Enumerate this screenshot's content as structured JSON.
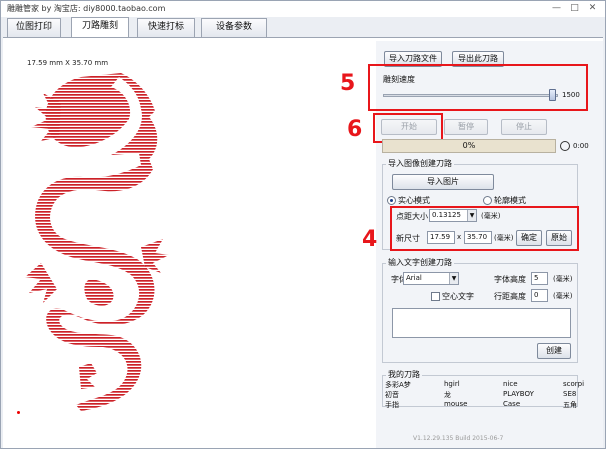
{
  "window": {
    "title": "雕雕管家 by 淘宝店: diy8000.taobao.com",
    "min": "—",
    "max": "□",
    "close": "✕"
  },
  "tabs": [
    "位图打印",
    "刀路雕刻",
    "快速打标",
    "设备参数"
  ],
  "canvas": {
    "dimension_label": "17.59 mm X 35.70 mm"
  },
  "toolbar": {
    "import_path": "导入刀路文件",
    "export_path": "导出此刀路"
  },
  "speed": {
    "label": "雕刻速度",
    "value": "1500",
    "level": 0.97
  },
  "controls": {
    "start": "开始",
    "pause": "暂停",
    "stop": "停止",
    "progress": "0%",
    "time": "0:00"
  },
  "image_path": {
    "group_title": "导入图像创建刀路",
    "import_image": "导入图片",
    "mode_solid": "实心模式",
    "mode_outline": "轮廓模式",
    "dot_size_label": "点距大小",
    "dot_size_value": "0.13125",
    "dot_unit": "(毫米)",
    "new_size_label": "新尺寸",
    "width": "17.59",
    "x": "x",
    "height": "35.70",
    "confirm": "确定",
    "original": "原始"
  },
  "text_path": {
    "group_title": "输入文字创建刀路",
    "font_label": "字体",
    "font_value": "Arial",
    "font_height_label": "字体高度",
    "font_height_value": "5",
    "unit": "(毫米)",
    "hollow": "空心文字",
    "line_height_label": "行距高度",
    "line_height_value": "0",
    "create": "创建"
  },
  "my_paths": {
    "group_title": "我的刀路",
    "items": [
      [
        "多彩A梦",
        "hgirl",
        "nice",
        "scorpi"
      ],
      [
        "初音",
        "龙",
        "PLAYBOY",
        "SE8"
      ],
      [
        "手指",
        "mouse",
        "Case",
        "五角"
      ]
    ]
  },
  "annotations": {
    "n5": "5",
    "n6": "6",
    "n4": "4"
  },
  "footer": {
    "version": "V1.12.29.135 Build 2015-06-7"
  },
  "colors": {
    "dragon": "#cc2128",
    "annotation": "#e8161b"
  }
}
